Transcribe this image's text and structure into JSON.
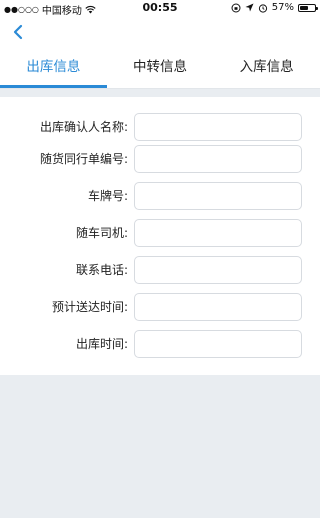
{
  "status_bar": {
    "carrier": "中国移动",
    "time": "00:55",
    "battery": "57%",
    "battery_level": 0.57
  },
  "nav": {
    "back_icon": "chevron-left-icon"
  },
  "tabs": [
    {
      "label": "出库信息",
      "active": true
    },
    {
      "label": "中转信息",
      "active": false
    },
    {
      "label": "入库信息",
      "active": false
    }
  ],
  "form": {
    "fields": [
      {
        "label": "出库确认人名称:",
        "value": "",
        "placeholder": ""
      },
      {
        "label": "随货同行单编号:",
        "value": "",
        "placeholder": ""
      },
      {
        "label": "车牌号:",
        "value": "",
        "placeholder": ""
      },
      {
        "label": "随车司机:",
        "value": "",
        "placeholder": ""
      },
      {
        "label": "联系电话:",
        "value": "",
        "placeholder": ""
      },
      {
        "label": "预计送达时间:",
        "value": "",
        "placeholder": ""
      },
      {
        "label": "出库时间:",
        "value": "",
        "placeholder": ""
      }
    ]
  },
  "colors": {
    "accent": "#2a8ad6",
    "background": "#e9edf1"
  }
}
